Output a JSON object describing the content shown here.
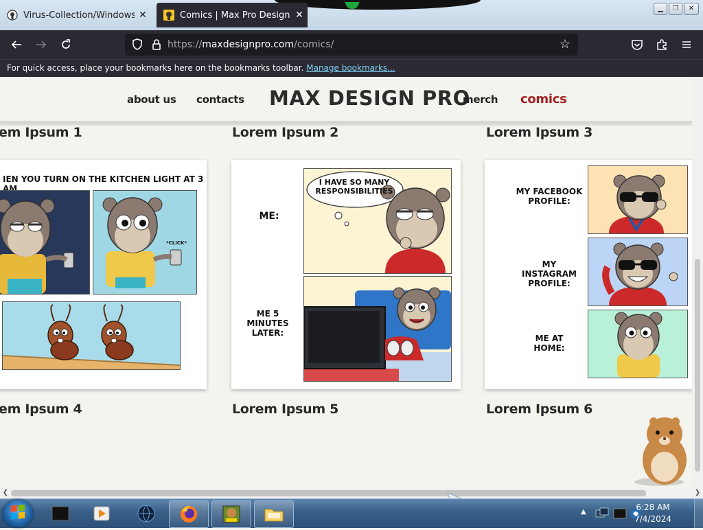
{
  "browser": {
    "tabs": [
      {
        "title": "Virus-Collection/Windows/Bina",
        "active": false
      },
      {
        "title": "Comics | Max Pro Design Anim",
        "active": true
      }
    ],
    "url_prefix": "https://",
    "url_host": "maxdesignpro.com",
    "url_path": "/comics/",
    "bookmarks_text": "For quick access, place your bookmarks here on the bookmarks toolbar.",
    "bookmarks_link": "Manage bookmarks..."
  },
  "site": {
    "nav": {
      "about": "about us",
      "contacts": "contacts",
      "logo": "MAX DESIGN PRO",
      "merch": "merch",
      "comics": "comics"
    },
    "comics": [
      {
        "title": "em Ipsum 1"
      },
      {
        "title": "Lorem Ipsum 2"
      },
      {
        "title": "Lorem Ipsum 3"
      },
      {
        "title": "em Ipsum 4"
      },
      {
        "title": "Lorem Ipsum 5"
      },
      {
        "title": "Lorem Ipsum 6"
      }
    ],
    "comic4": {
      "caption": "IEN YOU TURN ON THE KITCHEN LIGHT AT 3 AM",
      "click": "*CLICK*"
    },
    "comic5": {
      "bubble": "I HAVE SO MANY RESPONSIBILITIES",
      "me": "ME:",
      "later": "ME 5 MINUTES LATER:"
    },
    "comic6": {
      "facebook": "MY FACEBOOK PROFILE:",
      "instagram": "MY INSTAGRAM PROFILE:",
      "home": "ME AT HOME:"
    }
  },
  "taskbar": {
    "time": "6:28 AM",
    "date": "7/4/2024"
  },
  "colors": {
    "active_nav": "#a52222",
    "browser_bg": "#2b2a33",
    "page_bg": "#f4f4ef"
  }
}
